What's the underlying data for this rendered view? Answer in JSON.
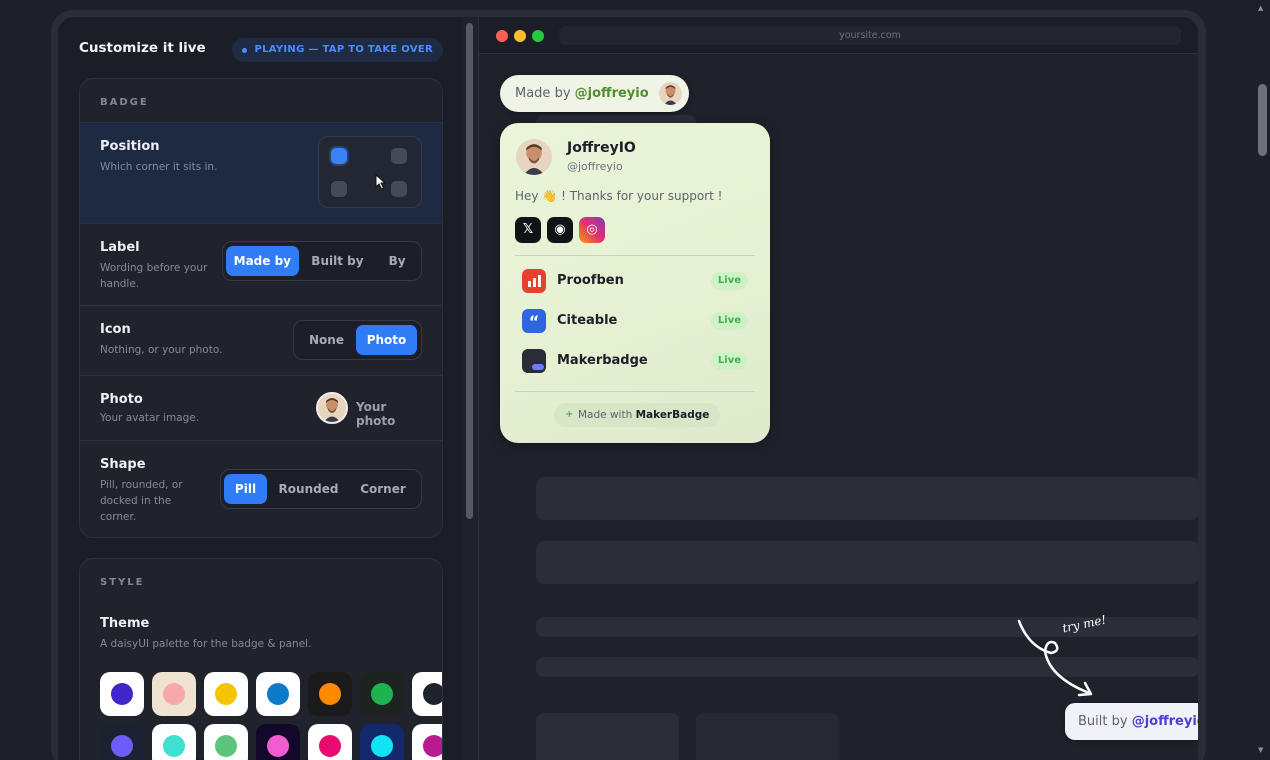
{
  "left": {
    "title": "Customize it live",
    "playing": "PLAYING — TAP TO TAKE OVER",
    "badge_section": {
      "title": "BADGE",
      "position": {
        "name": "Position",
        "desc": "Which corner it sits in.",
        "selected": "top-left"
      },
      "label": {
        "name": "Label",
        "desc": "Wording before your handle.",
        "options": [
          "Made by",
          "Built by",
          "By"
        ],
        "selected": "Made by"
      },
      "icon": {
        "name": "Icon",
        "desc": "Nothing, or your photo.",
        "options": [
          "None",
          "Photo"
        ],
        "selected": "Photo"
      },
      "photo": {
        "name": "Photo",
        "desc": "Your avatar image.",
        "button": "Your photo"
      },
      "shape": {
        "name": "Shape",
        "desc": "Pill, rounded, or docked in the corner.",
        "options": [
          "Pill",
          "Rounded",
          "Corner"
        ],
        "selected": "Pill"
      }
    },
    "style_section": {
      "title": "STYLE",
      "theme": {
        "name": "Theme",
        "desc": "A daisyUI palette for the badge & panel."
      },
      "themes": [
        {
          "bg": "#ffffff",
          "dot": "#4127c9"
        },
        {
          "bg": "#efe4d2",
          "dot": "#f7a8a8"
        },
        {
          "bg": "#ffffff",
          "dot": "#f5c400"
        },
        {
          "bg": "#ffffff",
          "dot": "#0a7ac9"
        },
        {
          "bg": "#1b1b1b",
          "dot": "#ff8a00"
        },
        {
          "bg": "#1d2420",
          "dot": "#1fb34f"
        },
        {
          "bg": "#ffffff",
          "dot": "#1f2330"
        },
        {
          "bg": "#1c2231",
          "dot": "#6d5cf6"
        },
        {
          "bg": "#ffffff",
          "dot": "#3fe0cf"
        },
        {
          "bg": "#ffffff",
          "dot": "#5cc47c"
        },
        {
          "bg": "#14082a",
          "dot": "#f35bd1"
        },
        {
          "bg": "#ffffff",
          "dot": "#ea0a6f"
        },
        {
          "bg": "#12296b",
          "dot": "#12e3f2"
        },
        {
          "bg": "#ffffff",
          "dot": "#b81a8f"
        }
      ]
    }
  },
  "preview": {
    "url": "yoursite.com",
    "badge_top": {
      "prefix": "Made by",
      "handle": "@joffreyio"
    },
    "panel": {
      "name": "JoffreyIO",
      "handle": "@joffreyio",
      "message": "Hey 👋 ! Thanks for your support !",
      "socials": [
        {
          "icon": "x-icon",
          "glyph": "𝕏"
        },
        {
          "icon": "github-icon",
          "glyph": "◉"
        },
        {
          "icon": "instagram-icon",
          "glyph": "◎"
        }
      ],
      "products": [
        {
          "name": "Proofben",
          "status": "Live",
          "color": "#e6412c"
        },
        {
          "name": "Citeable",
          "status": "Live",
          "color": "#2f66e0"
        },
        {
          "name": "Makerbadge",
          "status": "Live",
          "color": "#2a2d38"
        }
      ],
      "footer": {
        "prefix": "Made with",
        "brand": "MakerBadge"
      }
    },
    "try_me": "try me!",
    "badge_bottom": {
      "prefix": "Built by",
      "handle": "@joffreyio"
    }
  }
}
